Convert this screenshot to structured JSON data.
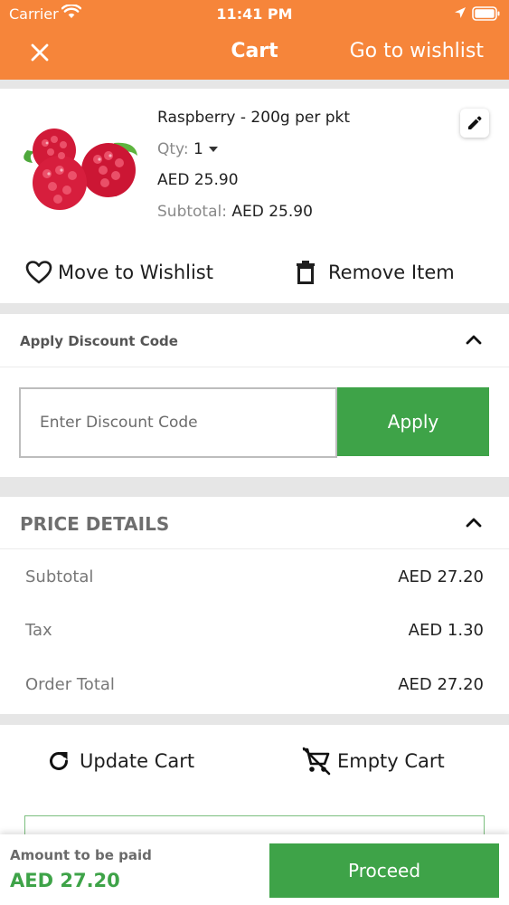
{
  "status_bar": {
    "carrier": "Carrier",
    "time": "11:41 PM"
  },
  "nav": {
    "title": "Cart",
    "wishlist_link": "Go to wishlist"
  },
  "cart_item": {
    "name": "Raspberry - 200g per pkt",
    "qty_label": "Qty:",
    "qty_value": "1",
    "price": "AED 25.90",
    "subtotal_label": "Subtotal:",
    "subtotal_value": "AED 25.90",
    "move_to_wishlist": "Move to Wishlist",
    "remove_item": "Remove Item"
  },
  "discount": {
    "title": "Apply Discount Code",
    "placeholder": "Enter Discount Code",
    "apply_label": "Apply"
  },
  "price_details": {
    "title": "PRICE DETAILS",
    "rows": [
      {
        "label": "Subtotal",
        "value": "AED 27.20"
      },
      {
        "label": "Tax",
        "value": "AED 1.30"
      },
      {
        "label": "Order Total",
        "value": "AED 27.20"
      }
    ]
  },
  "cart_actions": {
    "update_cart": "Update Cart",
    "empty_cart": "Empty Cart"
  },
  "footer": {
    "amount_label": "Amount to be paid",
    "amount_value": "AED 27.20",
    "proceed_label": "Proceed"
  },
  "colors": {
    "header": "#f6853a",
    "accent_green": "#3ea348",
    "background": "#e6e6e6"
  },
  "icons": [
    "wifi-icon",
    "location-arrow-icon",
    "battery-icon",
    "close-icon",
    "edit-pencil-icon",
    "heart-outline-icon",
    "trash-icon",
    "chevron-up-icon",
    "refresh-icon",
    "cart-remove-icon",
    "caret-down-icon"
  ]
}
